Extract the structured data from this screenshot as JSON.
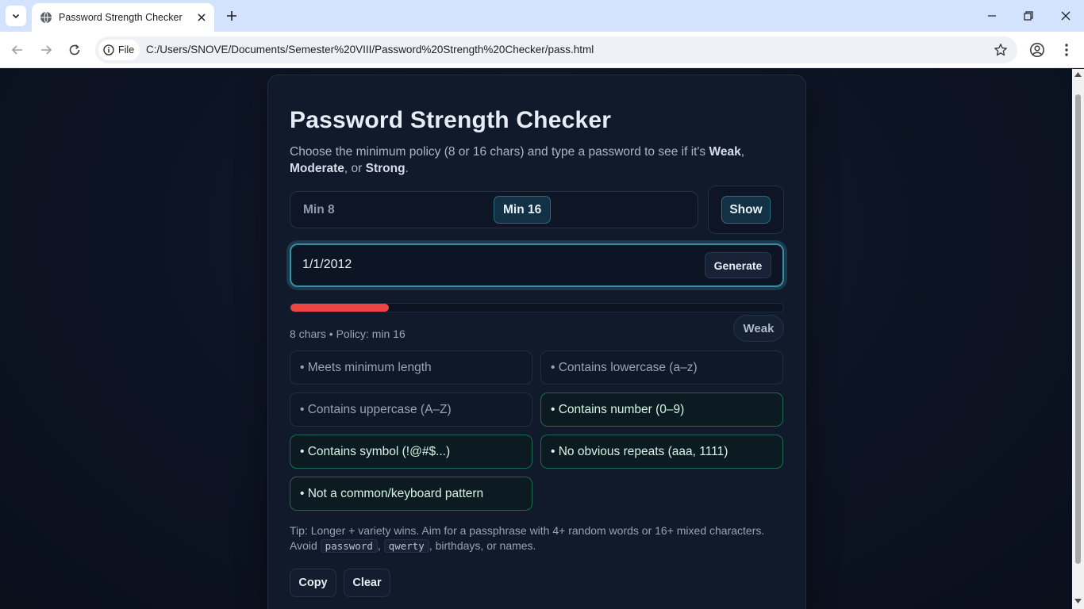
{
  "browser": {
    "tab_title": "Password Strength Checker",
    "site_chip": "File",
    "url": "C:/Users/SNOVE/Documents/Semester%20VIII/Password%20Strength%20Checker/pass.html"
  },
  "app": {
    "title": "Password Strength Checker",
    "subtitle_prefix": "Choose the minimum policy (8 or 16 chars) and type a password to see if it's ",
    "subtitle_weak": "Weak",
    "subtitle_sep1": ", ",
    "subtitle_moderate": "Moderate",
    "subtitle_sep2": ", or ",
    "subtitle_strong": "Strong",
    "subtitle_end": ".",
    "policy_options": [
      "Min 8",
      "Min 16"
    ],
    "selected_policy": "Min 16",
    "show_label": "Show",
    "password_value": "1/1/2012",
    "generate_label": "Generate",
    "strength_fraction": 0.2,
    "meter_color": "#ef4444",
    "meta_text": "8 chars • Policy: min 16",
    "strength_label": "Weak",
    "criteria": [
      {
        "label": "• Meets minimum length",
        "met": false
      },
      {
        "label": "• Contains lowercase (a–z)",
        "met": false
      },
      {
        "label": "• Contains uppercase (A–Z)",
        "met": false
      },
      {
        "label": "• Contains number (0–9)",
        "met": true
      },
      {
        "label": "• Contains symbol (!@#$...)",
        "met": true
      },
      {
        "label": "• No obvious repeats (aaa, 1111)",
        "met": true
      },
      {
        "label": "• Not a common/keyboard pattern",
        "met": true
      }
    ],
    "tip_line1": "Tip: Longer + variety wins. Aim for a passphrase with 4+ random words or 16+ mixed characters.",
    "tip_avoid": "Avoid",
    "tip_code1": "password",
    "tip_comma": ",",
    "tip_code2": "qwerty",
    "tip_end": ", birthdays, or names.",
    "copy_label": "Copy",
    "clear_label": "Clear"
  }
}
